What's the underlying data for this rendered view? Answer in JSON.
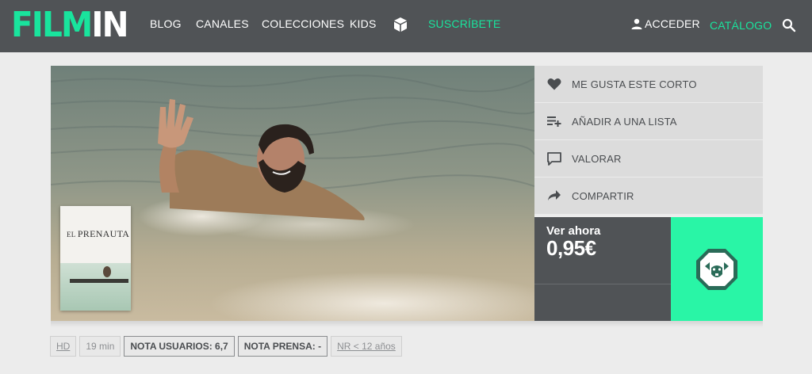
{
  "logo": {
    "part1": "FILM",
    "part2": "IN"
  },
  "nav": {
    "blog": "BLOG",
    "canales": "CANALES",
    "colecciones": "COLECCIONES",
    "kids": "KIDS",
    "suscribete": "SUSCRÍBETE",
    "acceder": "ACCEDER",
    "catalogo": "CATÁLOGO"
  },
  "poster": {
    "prefix": "EL ",
    "title": "PRENAUTA"
  },
  "actions": {
    "like": "ME GUSTA ESTE CORTO",
    "add_list": "AÑADIR A UNA LISTA",
    "rate": "VALORAR",
    "share": "COMPARTIR"
  },
  "purchase": {
    "label": "Ver ahora",
    "price": "0,95€"
  },
  "badges": {
    "quality": "HD",
    "duration": "19 min",
    "user_rating": "NOTA USUARIOS: 6,7",
    "press_rating": "NOTA PRENSA: -",
    "age_rating": "NR < 12 años"
  },
  "colors": {
    "accent": "#19e49d",
    "play_bg": "#29f5a6",
    "nav_bg": "#505356"
  }
}
